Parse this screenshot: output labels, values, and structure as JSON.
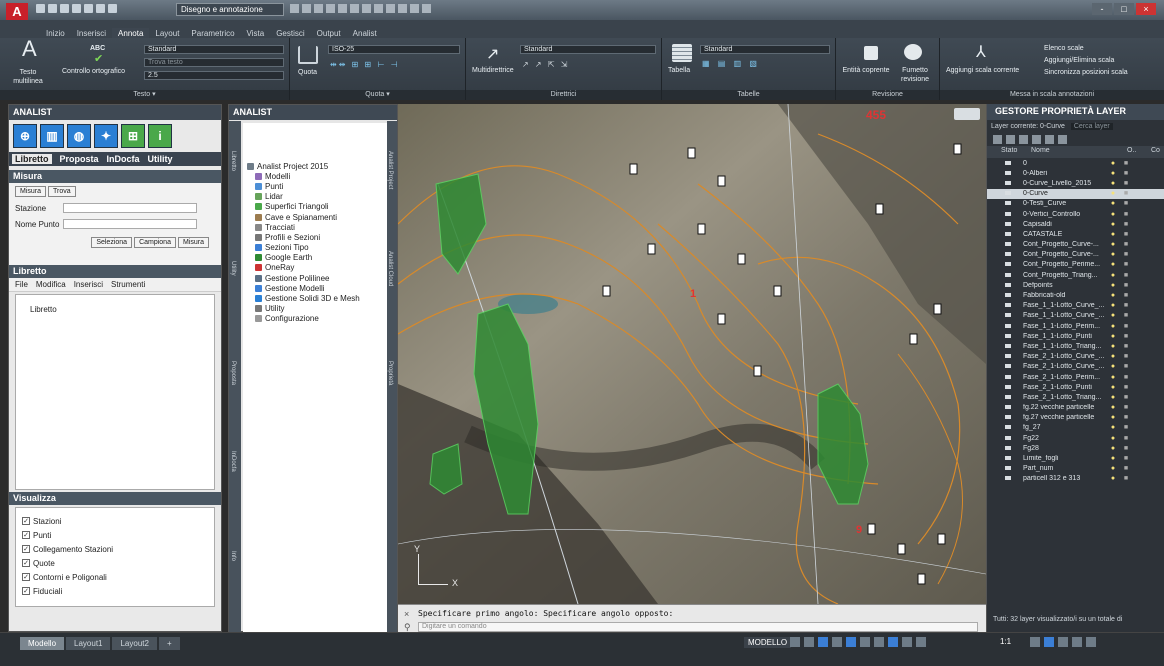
{
  "titlebar": {
    "workspace": "Disegno e annotazione",
    "app_logo": "A",
    "min": "-",
    "max": "□",
    "close": "×"
  },
  "ribbon_tabs": [
    "Inizio",
    "Inserisci",
    "Annota",
    "Layout",
    "Parametrico",
    "Vista",
    "Gestisci",
    "Output",
    "Analist"
  ],
  "ribbon_active_tab": "Annota",
  "ribbon": {
    "testo": {
      "big": "Testo multilinea",
      "check": "Controllo ortografico",
      "abc": "ABC",
      "style": "Standard",
      "find": "Trova testo",
      "height": "2.5",
      "footer": "Testo ▾"
    },
    "quota": {
      "big": "Quota",
      "style": "ISO-25",
      "footer": "Quota ▾"
    },
    "direttrici": {
      "big": "Multidirettrice",
      "style": "Standard",
      "footer": "Direttrici"
    },
    "tabelle": {
      "big": "Tabella",
      "style": "Standard",
      "footer": "Tabelle"
    },
    "revisione": {
      "a": "Entità coprente",
      "b": "Fumetto revisione",
      "footer": "Revisione"
    },
    "scala": {
      "add": "Aggiungi scala corrente",
      "list": "Elenco scale",
      "addremove": "Aggiungi/Elimina scala",
      "sync": "Sincronizza posizioni scala",
      "footer": "Messa in scala annotazioni"
    }
  },
  "left": {
    "title": "ANALIST",
    "tabs": [
      "Libretto",
      "Proposta",
      "InDocfa",
      "Utility"
    ],
    "misura": {
      "header": "Misura",
      "subtabs": [
        "Misura",
        "Trova"
      ],
      "stazione_label": "Stazione",
      "nome_punto_label": "Nome Punto",
      "buttons": [
        "Seleziona",
        "Campiona",
        "Misura"
      ]
    },
    "libretto": {
      "header": "Libretto",
      "menu": [
        "File",
        "Modifica",
        "Inserisci",
        "Strumenti"
      ],
      "root": "Libretto"
    },
    "visualizza": {
      "header": "Visualizza",
      "items": [
        "Stazioni",
        "Punti",
        "Collegamento Stazioni",
        "Quote",
        "Contorni e Poligonali",
        "Fiduciali"
      ]
    }
  },
  "mid": {
    "title": "ANALIST",
    "vtabs_left": [
      "Libretto",
      "Utility",
      "Proposta",
      "InDocfa",
      "Info"
    ],
    "vtabs_right": [
      "Analist Project",
      "Analist Cloud",
      "Proprietà"
    ],
    "tree": [
      "Analist Project 2015",
      "Modelli",
      "Punti",
      "Lidar",
      "Superfici Triangoli",
      "Cave e Spianamenti",
      "Tracciati",
      "Profili e Sezioni",
      "Sezioni Tipo",
      "Google Earth",
      "OneRay",
      "Gestione Polilinee",
      "Gestione Modelli",
      "Gestione Solidi 3D e Mesh",
      "Utility",
      "Configurazione"
    ]
  },
  "map": {
    "labels": [
      "455",
      "1",
      "9"
    ],
    "axis_y": "Y",
    "axis_x": "X"
  },
  "cmd": {
    "text": "Specificare primo angolo: Specificare angolo opposto:",
    "placeholder": "Digitare un comando"
  },
  "right": {
    "title": "GESTORE PROPRIETÀ LAYER",
    "current": "Layer corrente: 0-Curve",
    "search": "Cerca layer",
    "headers": [
      "Stato",
      "Nome",
      "O..",
      "Co"
    ],
    "layers": [
      "0",
      "0-Alberi",
      "0-Curve_Livello_2015",
      "0-Curve",
      "0-Testi_Curve",
      "0-Vertici_Controllo",
      "Capisaldi",
      "CATASTALE",
      "Cont_Progetto_Curve-...",
      "Cont_Progetto_Curve-...",
      "Cont_Progetto_Perime...",
      "Cont_Progetto_Triang...",
      "Defpoints",
      "Fabbricati-old",
      "Fase_1_1-Lotto_Curve_...",
      "Fase_1_1-Lotto_Curve_...",
      "Fase_1_1-Lotto_Perim...",
      "Fase_1_1-Lotto_Punti",
      "Fase_1_1-Lotto_Triang...",
      "Fase_2_1-Lotto_Curve_...",
      "Fase_2_1-Lotto_Curve_...",
      "Fase_2_1-Lotto_Perim...",
      "Fase_2_1-Lotto_Punti",
      "Fase_2_1-Lotto_Triang...",
      "fg.22 vecchie particelle",
      "fg.27 vecchie particelle",
      "fg_27",
      "Fg22",
      "Fg28",
      "Limite_fogli",
      "Part_num",
      "particell 312 e 313"
    ],
    "selected_index": 3,
    "footer": "Tutti: 32 layer visualizzato/i su un totale di"
  },
  "status": {
    "tabs": [
      "Modello",
      "Layout1",
      "Layout2",
      "+"
    ],
    "active": "Modello",
    "modello": "MODELLO",
    "scale": "1:1"
  },
  "colors": {
    "accent": "#c8202a",
    "ribbon": "#3a434c",
    "panel_dark": "#2d3238"
  }
}
